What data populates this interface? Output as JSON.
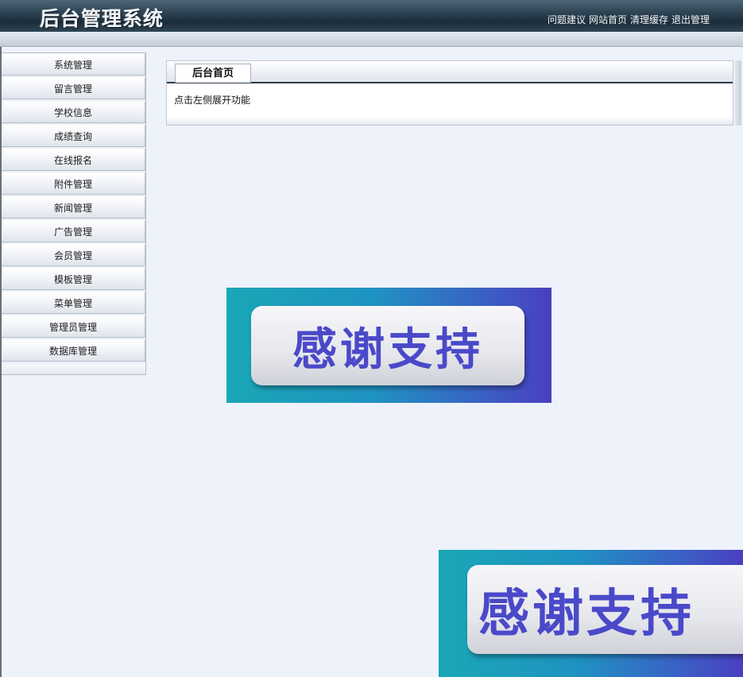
{
  "header": {
    "title": "后台管理系统",
    "links": [
      "问题建议",
      "网站首页",
      "清理缓存",
      "退出管理"
    ]
  },
  "sidebar": {
    "items": [
      {
        "label": "系统管理"
      },
      {
        "label": "留言管理"
      },
      {
        "label": "学校信息"
      },
      {
        "label": "成绩查询"
      },
      {
        "label": "在线报名"
      },
      {
        "label": "附件管理"
      },
      {
        "label": "新闻管理"
      },
      {
        "label": "广告管理"
      },
      {
        "label": "会员管理"
      },
      {
        "label": "模板管理"
      },
      {
        "label": "菜单管理"
      },
      {
        "label": "管理员管理"
      },
      {
        "label": "数据库管理"
      }
    ]
  },
  "main": {
    "tab_label": "后台首页",
    "content_text": "点击左侧展开功能"
  },
  "banners": {
    "text": "感谢支持"
  },
  "colors": {
    "header_dark": "#1c2d3a",
    "page_bg": "#eef2fa",
    "banner_text": "#4a49c9"
  }
}
